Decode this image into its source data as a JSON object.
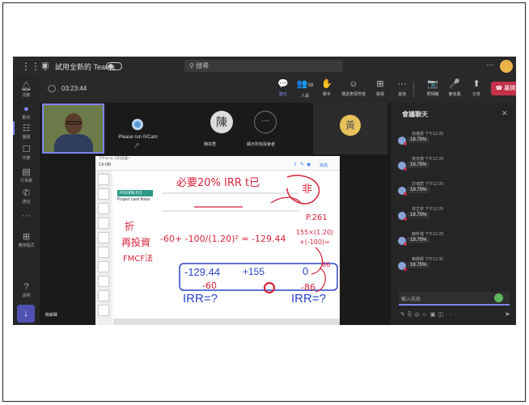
{
  "topbar": {
    "try_label": "試用全新的 Teams",
    "search_placeholder": "搜尋",
    "more": "···"
  },
  "rail": [
    {
      "icon": "bell-icon",
      "label": "活動"
    },
    {
      "icon": "chat-icon",
      "label": "聊天"
    },
    {
      "icon": "teams-icon",
      "label": "團隊"
    },
    {
      "icon": "assignments-icon",
      "label": "作業"
    },
    {
      "icon": "calendar-icon",
      "label": "行事曆"
    },
    {
      "icon": "calls-icon",
      "label": "通話"
    },
    {
      "icon": "more-icon",
      "label": "···"
    },
    {
      "icon": "apps-icon",
      "label": "應用程式"
    },
    {
      "icon": "help-icon",
      "label": "說明"
    }
  ],
  "meeting": {
    "timer": "03:23:44",
    "controls": [
      {
        "label": "聊天",
        "icon": "💬",
        "active": true
      },
      {
        "label": "人員",
        "icon": "👥",
        "badge": "58"
      },
      {
        "label": "舉手",
        "icon": "✋"
      },
      {
        "label": "傳送表情符號",
        "icon": "☺"
      },
      {
        "label": "檢視",
        "icon": "⊞"
      },
      {
        "label": "其他",
        "icon": "···"
      },
      {
        "label": "照相機",
        "icon": "📷"
      },
      {
        "label": "麥克風",
        "icon": "🎤"
      },
      {
        "label": "分享",
        "icon": "⬆"
      }
    ],
    "leave_label": "離開"
  },
  "stage": {
    "ivcam_text": "Please run iVCam",
    "chen_avatar": "陳",
    "chen_name": "陳宗君",
    "show_all_label": "顯示所有與會者",
    "show_all_icon": "···",
    "huang_avatar": "黃",
    "presenter_badge": "簡錫聲"
  },
  "screenshare": {
    "status": "下午12:31 1月9日週一",
    "filename": "Ch-08i",
    "done_label": "完成",
    "figure_label": "FIGURE 8.5",
    "figure_caption": "Project cash flows",
    "ink": {
      "headline": "必要20% IRR t已",
      "fei": "非",
      "p261": "P.261",
      "equation": "-60+ -100/(1.20)² = -129.44",
      "rhs": "155×(1.20)",
      "rhs2": "+(-100)=",
      "left_note": "折",
      "left_note2": "再投資",
      "left_note3": "FMCF法",
      "box_left": "-129.44",
      "box_mid": "+155",
      "box_right": "0",
      "val_86": "86",
      "val_60": "-60",
      "val_86b": "-86",
      "irr1": "IRR=?",
      "irr2": "IRR=?"
    }
  },
  "chat": {
    "title": "會議聊天",
    "messages": [
      {
        "meta": "徐儀晨 下午12:29",
        "text": "19.75%"
      },
      {
        "meta": "吳安樣 下午12:29",
        "text": "19.75%"
      },
      {
        "meta": "許瑞宸 下午12:29",
        "text": "19.75%"
      },
      {
        "meta": "林芷寧 下午12:29",
        "text": "19.75%"
      },
      {
        "meta": "賴昕儀 下午12:29",
        "text": "19.75%"
      },
      {
        "meta": "賴靜媛 下午12:30",
        "text": "19.75%"
      }
    ],
    "input_placeholder": "輸入訊息"
  },
  "colors": {
    "accent": "#7f85f5",
    "leave": "#c4314b",
    "ink_red": "#d8233a",
    "ink_blue": "#2a43c9"
  }
}
